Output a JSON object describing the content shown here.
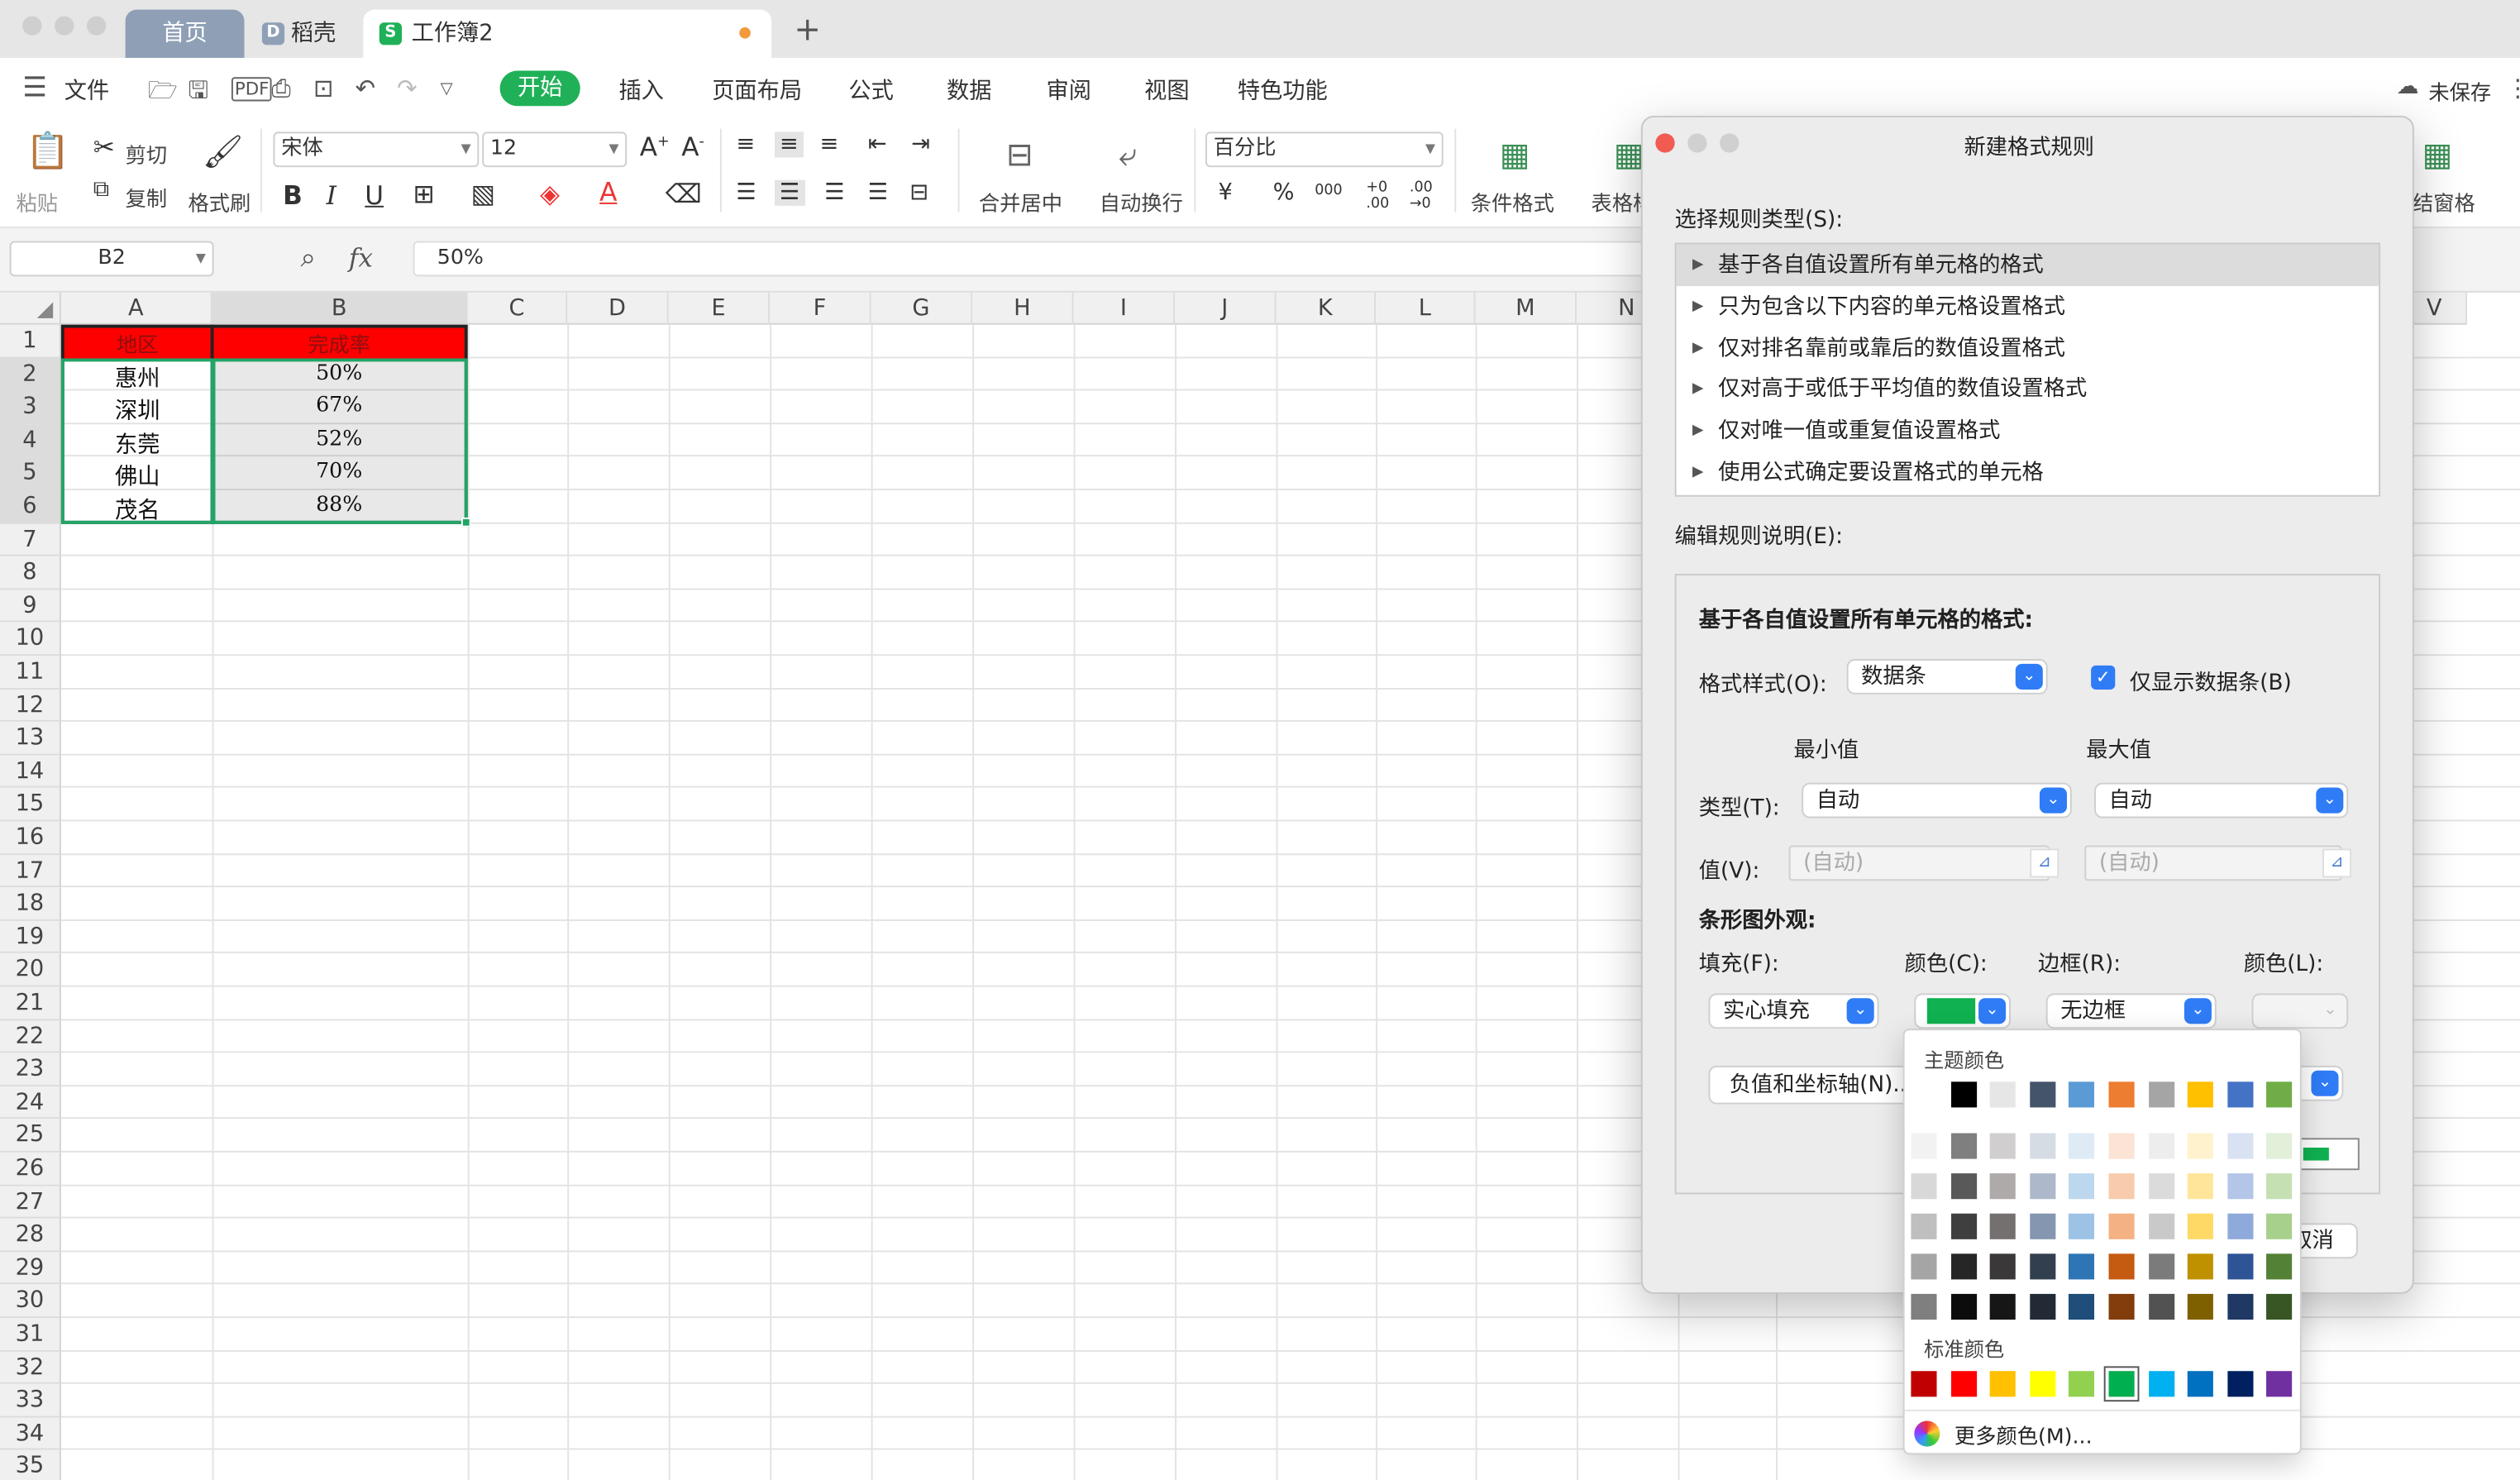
{
  "window": {
    "tabs": [
      {
        "label": "首页"
      },
      {
        "label": "稻壳"
      },
      {
        "label": "工作簿2"
      }
    ],
    "new_tab": "+"
  },
  "menubar": {
    "file": "文件",
    "items": [
      "开始",
      "插入",
      "页面布局",
      "公式",
      "数据",
      "审阅",
      "视图",
      "特色功能"
    ],
    "unsaved": "未保存"
  },
  "ribbon": {
    "paste": "粘贴",
    "cut": "剪切",
    "copy": "复制",
    "format_painter": "格式刷",
    "font_name": "宋体",
    "font_size": "12",
    "merge_center": "合并居中",
    "auto_wrap": "自动换行",
    "number_format": "百分比",
    "conditional_format": "条件格式",
    "table_style": "表格样",
    "freeze": "结窗格"
  },
  "formula_bar": {
    "name_box": "B2",
    "fx": "fx",
    "value": "50%"
  },
  "grid": {
    "columns": [
      "A",
      "B",
      "C",
      "D",
      "E",
      "F",
      "G",
      "H",
      "I",
      "J",
      "K",
      "L",
      "M",
      "N",
      "V"
    ],
    "rows": [
      "1",
      "2",
      "3",
      "4",
      "5",
      "6",
      "7",
      "8",
      "9",
      "10",
      "11",
      "12",
      "13",
      "14",
      "15",
      "16",
      "17",
      "18",
      "19",
      "20",
      "21",
      "22",
      "23",
      "24",
      "25",
      "26",
      "27",
      "28",
      "29",
      "30",
      "31",
      "32",
      "33",
      "34",
      "35"
    ],
    "header": [
      "地区",
      "完成率"
    ],
    "data": [
      [
        "惠州",
        "50%"
      ],
      [
        "深圳",
        "67%"
      ],
      [
        "东莞",
        "52%"
      ],
      [
        "佛山",
        "70%"
      ],
      [
        "茂名",
        "88%"
      ]
    ]
  },
  "dialog": {
    "title": "新建格式规则",
    "select_rule_type": "选择规则类型(S):",
    "rules": [
      "基于各自值设置所有单元格的格式",
      "只为包含以下内容的单元格设置格式",
      "仅对排名靠前或靠后的数值设置格式",
      "仅对高于或低于平均值的数值设置格式",
      "仅对唯一值或重复值设置格式",
      "使用公式确定要设置格式的单元格"
    ],
    "edit_rule_desc": "编辑规则说明(E):",
    "section_title": "基于各自值设置所有单元格的格式:",
    "format_style_label": "格式样式(O):",
    "format_style_value": "数据条",
    "show_bar_only": "仅显示数据条(B)",
    "min_label": "最小值",
    "max_label": "最大值",
    "type_label": "类型(T):",
    "min_type": "自动",
    "max_type": "自动",
    "value_label": "值(V):",
    "min_value_placeholder": "(自动)",
    "max_value_placeholder": "(自动)",
    "bar_appearance": "条形图外观:",
    "fill_label": "填充(F):",
    "fill_color_label": "颜色(C):",
    "border_label": "边框(R):",
    "border_color_label": "颜色(L):",
    "fill_value": "实心填充",
    "border_value": "无边框",
    "negative_axis_btn": "负值和坐标轴(N)...",
    "cancel_partial": "取消",
    "fill_color": "#10b150"
  },
  "palette": {
    "theme_title": "主题颜色",
    "standard_title": "标准颜色",
    "more_colors": "更多颜色(M)...",
    "theme_top": [
      "#ffffff",
      "#000000",
      "#e7e6e6",
      "#44546a",
      "#5b9bd5",
      "#ed7d31",
      "#a5a5a5",
      "#ffc000",
      "#4472c4",
      "#70ad47"
    ],
    "theme_rows": [
      [
        "#f2f2f2",
        "#7f7f7f",
        "#d0cece",
        "#d6dce4",
        "#deebf6",
        "#fbe4d5",
        "#ededed",
        "#fff2cc",
        "#d9e2f3",
        "#e2efd9"
      ],
      [
        "#d8d8d8",
        "#595959",
        "#aeaaaa",
        "#adb9ca",
        "#bdd7ee",
        "#f7cbac",
        "#dbdbdb",
        "#fee599",
        "#b4c6e7",
        "#c5e0b3"
      ],
      [
        "#bfbfbf",
        "#3f3f3f",
        "#757070",
        "#8496b0",
        "#9cc3e5",
        "#f4b183",
        "#c9c9c9",
        "#ffd965",
        "#8eaadb",
        "#a8d08d"
      ],
      [
        "#a5a5a5",
        "#262626",
        "#3a3838",
        "#323f4f",
        "#2e75b5",
        "#c55a11",
        "#7b7b7b",
        "#bf9000",
        "#2f5496",
        "#538135"
      ],
      [
        "#7f7f7f",
        "#0c0c0c",
        "#171616",
        "#222a35",
        "#1e4e79",
        "#833c0b",
        "#525252",
        "#7f6000",
        "#1f3864",
        "#375623"
      ]
    ],
    "standard": [
      "#c00000",
      "#ff0000",
      "#ffc000",
      "#ffff00",
      "#92d050",
      "#00b050",
      "#00b0f0",
      "#0070c0",
      "#002060",
      "#7030a0"
    ]
  }
}
